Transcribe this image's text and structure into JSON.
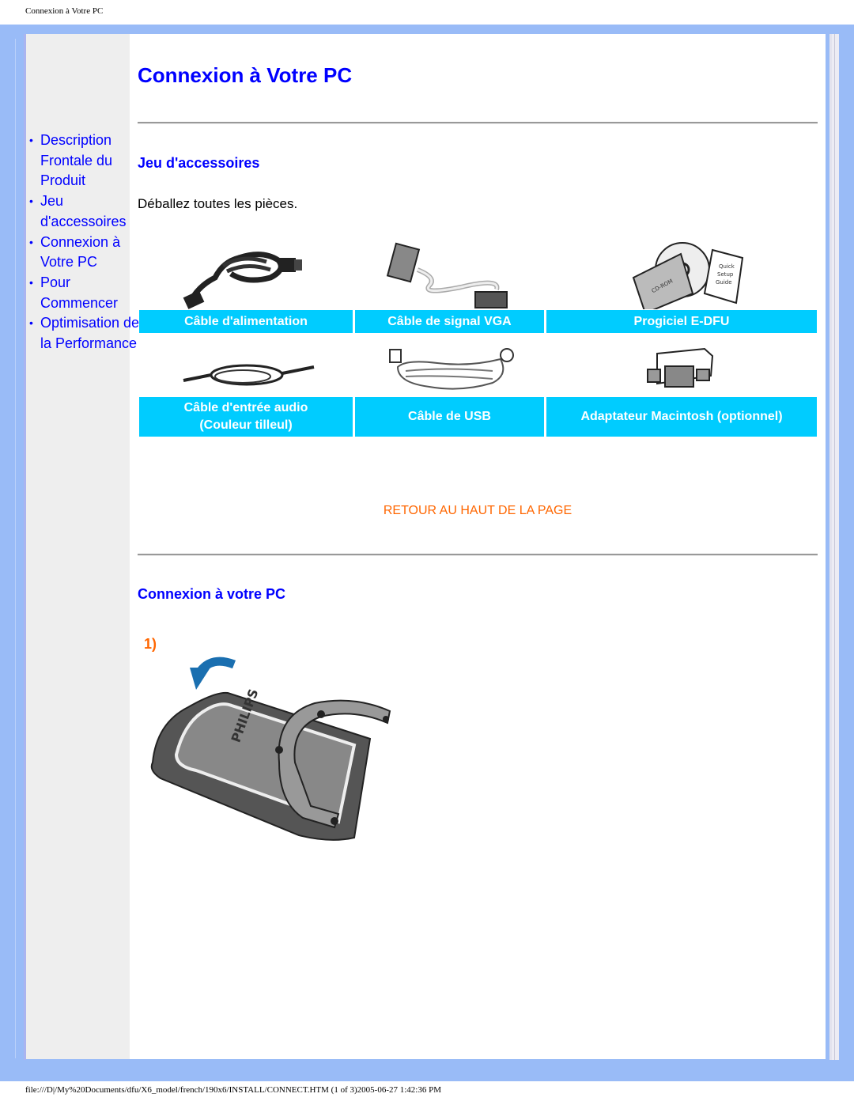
{
  "print_header": "Connexion à Votre PC",
  "print_footer": "file:///D|/My%20Documents/dfu/X6_model/french/190x6/INSTALL/CONNECT.HTM (1 of 3)2005-06-27 1:42:36 PM",
  "sidebar": {
    "items": [
      {
        "label": "Description Frontale du Produit"
      },
      {
        "label": "Jeu d'accessoires"
      },
      {
        "label": "Connexion à Votre PC"
      },
      {
        "label": "Pour Commencer"
      },
      {
        "label": "Optimisation de la Performance"
      }
    ]
  },
  "main": {
    "title": "Connexion à Votre PC",
    "accessories": {
      "heading": "Jeu d'accessoires",
      "intro": "Déballez toutes les pièces.",
      "row1": [
        {
          "label": "Câble d'alimentation",
          "icon": "power-cable-icon"
        },
        {
          "label": "Câble de signal VGA",
          "icon": "vga-cable-icon"
        },
        {
          "label": "Progiciel E-DFU",
          "icon": "cd-rom-icon"
        }
      ],
      "row2": [
        {
          "label": "Câble d'entrée audio",
          "label_line2": "(Couleur tilleul)",
          "icon": "audio-cable-icon"
        },
        {
          "label": "Câble de USB",
          "icon": "usb-cable-icon"
        },
        {
          "label": "Adaptateur Macintosh (optionnel)",
          "icon": "mac-adapter-icon"
        }
      ],
      "cd_text": "CD-ROM",
      "guide_text": [
        "Quick",
        "Setup",
        "Guide"
      ]
    },
    "back_to_top": "RETOUR AU HAUT DE LA PAGE",
    "connection": {
      "heading": "Connexion à votre PC",
      "step": "1)",
      "brand_text": "PHILIPS"
    }
  },
  "colors": {
    "frame": "#99bbf7",
    "link": "#0000ff",
    "label_bg": "#00ccff",
    "accent_orange": "#ff6600",
    "arrow_blue": "#1a6fb0"
  }
}
